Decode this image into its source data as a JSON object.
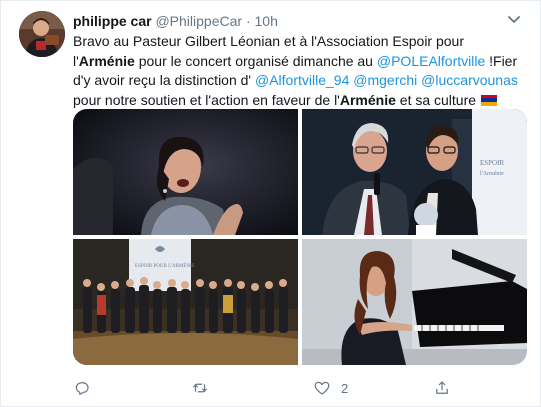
{
  "tweet": {
    "author_name": "philippe car",
    "author_handle": "@PhilippeCar",
    "separator": "·",
    "time": "10h",
    "text": {
      "t1": "Bravo au Pasteur Gilbert Léonian et à l'Association Espoir pour l'",
      "b1": "Arménie",
      "t2": " pour le concert organisé dimanche au ",
      "m1": "@POLEAlfortville",
      "t3": " !Fier d'y avoir reçu la distinction d' ",
      "m2": "@Alfortville_94",
      "t4": " ",
      "m3": "@mgerchi",
      "t5": " ",
      "m4": "@luccarvounas",
      "t6": " pour notre soutien et l'action en faveur de l'",
      "b2": "Arménie",
      "t7": " et sa culture "
    },
    "flag_icon": "armenian-flag-emoji",
    "flag_colors": [
      "#d90012",
      "#0033a0",
      "#f2a800"
    ],
    "banner_text": "ESPOIR POUR L'ARMÉNIE",
    "like_count": "2"
  },
  "icons": {
    "more": "chevron-down-icon",
    "reply": "reply-icon",
    "retweet": "retweet-icon",
    "like": "heart-icon",
    "share": "share-icon"
  },
  "colors": {
    "link": "#1b95e0",
    "secondary": "#657786",
    "text": "#14171a"
  }
}
